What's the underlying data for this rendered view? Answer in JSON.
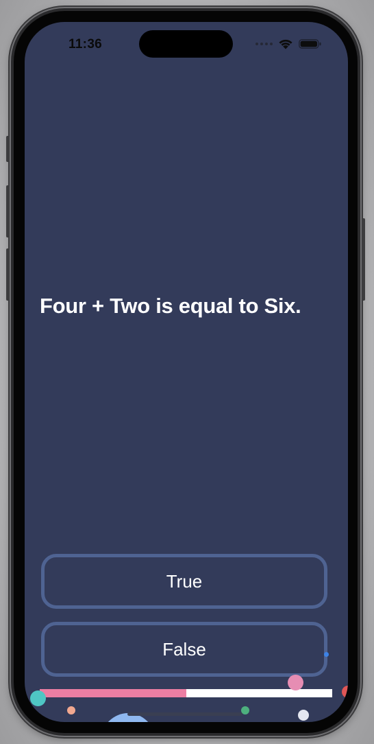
{
  "status_bar": {
    "time": "11:36"
  },
  "quiz": {
    "question": "Four + Two is equal to Six.",
    "answers": [
      "True",
      "False"
    ],
    "progress": 0.5
  },
  "colors": {
    "screen_bg": "#333b5a",
    "button_border": "#4f6392",
    "progress_fill": "#ec7ea3",
    "progress_track": "#ffffff"
  }
}
